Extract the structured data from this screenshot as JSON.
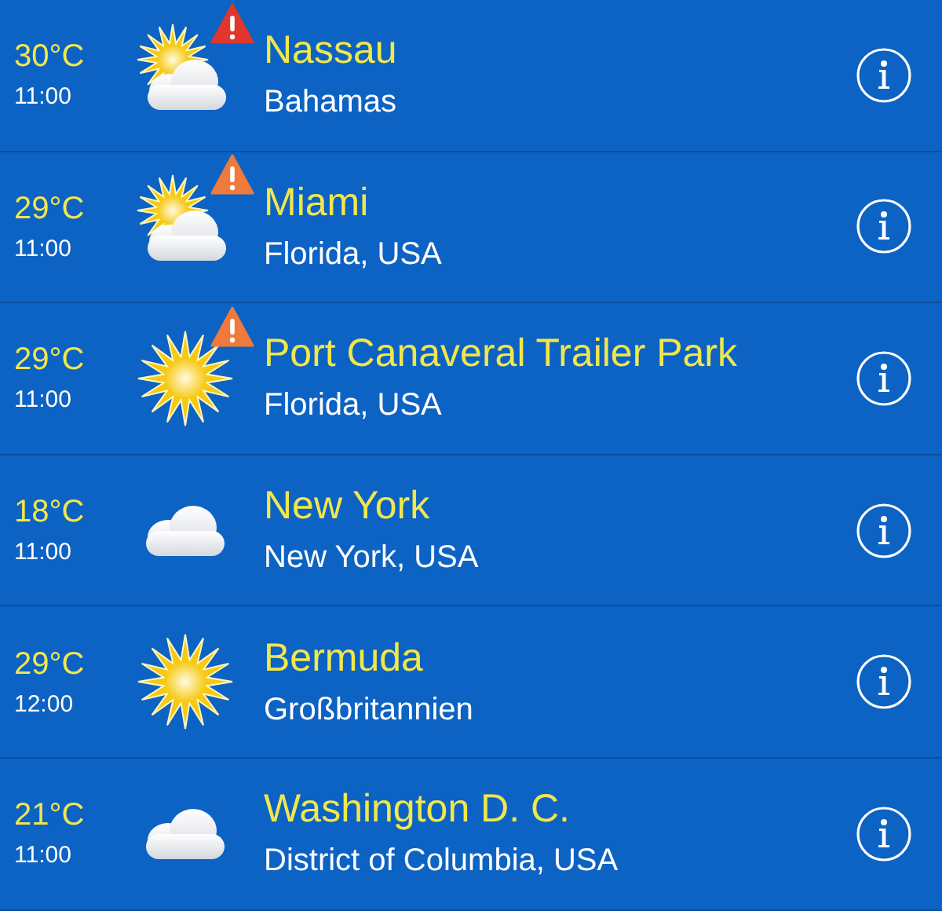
{
  "locations": [
    {
      "temperature": "30°C",
      "time": "11:00",
      "kind": "partly_cloudy",
      "warning": {
        "color": "#e0362c"
      },
      "name": "Nassau",
      "region": "Bahamas"
    },
    {
      "temperature": "29°C",
      "time": "11:00",
      "kind": "partly_cloudy",
      "warning": {
        "color": "#ef7a3c"
      },
      "name": "Miami",
      "region": "Florida, USA"
    },
    {
      "temperature": "29°C",
      "time": "11:00",
      "kind": "sunny",
      "warning": {
        "color": "#ef7a3c"
      },
      "name": "Port Canaveral Trailer Park",
      "region": "Florida, USA"
    },
    {
      "temperature": "18°C",
      "time": "11:00",
      "kind": "cloudy",
      "name": "New York",
      "region": "New York, USA"
    },
    {
      "temperature": "29°C",
      "time": "12:00",
      "kind": "sunny",
      "name": "Bermuda",
      "region": "Großbritannien"
    },
    {
      "temperature": "21°C",
      "time": "11:00",
      "kind": "cloudy",
      "name": "Washington D. C.",
      "region": "District of Columbia, USA"
    }
  ]
}
